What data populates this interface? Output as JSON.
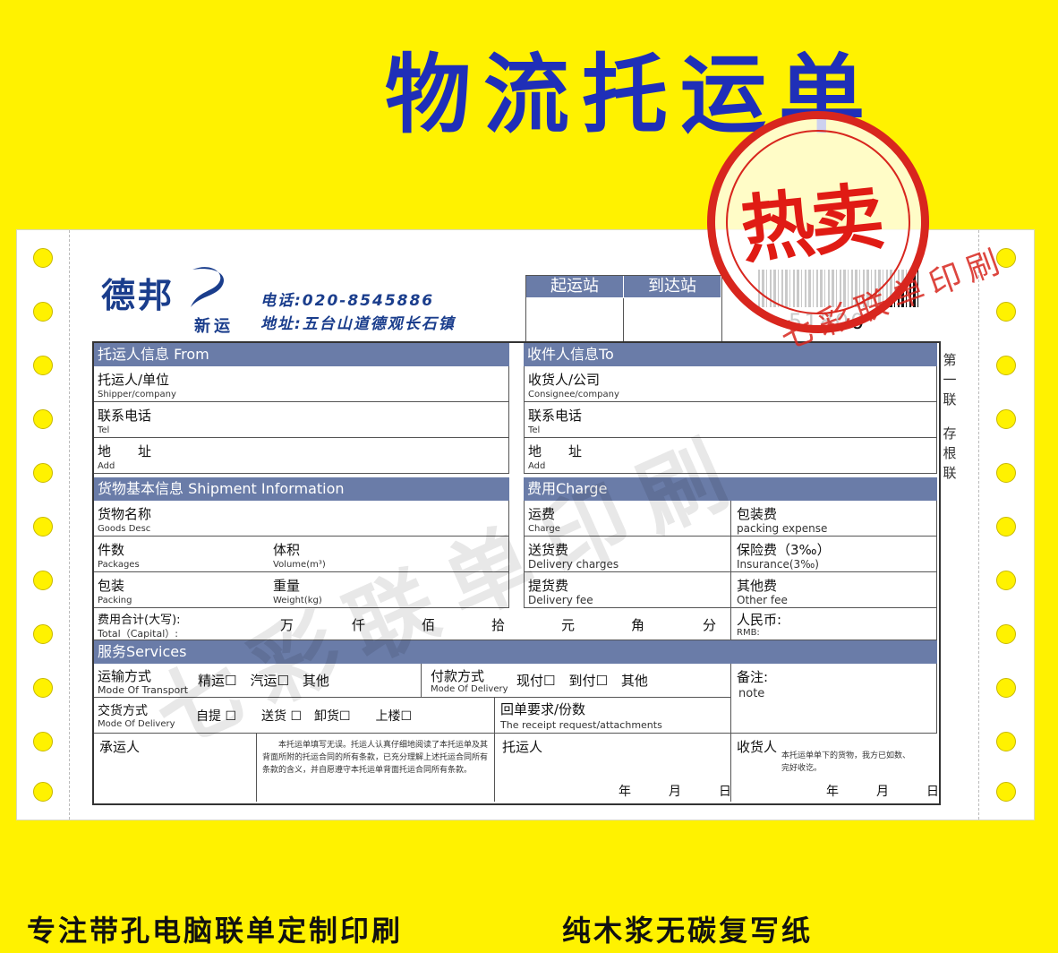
{
  "page_title": "物流托运单",
  "stamp": {
    "main": "热卖",
    "arc": "七彩联单印刷"
  },
  "watermark": "七彩联单印刷",
  "company": {
    "logo_text": "德邦",
    "logo_sub": "新运",
    "phone": "电话:020-8545886",
    "address": "地址:五台山道德观长石镇"
  },
  "stations": {
    "origin": "起运站",
    "destination": "到达站"
  },
  "barcode_number": "51800",
  "side_label": [
    "第一联",
    "存根联"
  ],
  "sections": {
    "shipper": "托运人信息 From",
    "consignee": "收件人信息To",
    "goods": "货物基本信息 Shipment Information",
    "charge": "费用Charge",
    "services": "服务Services"
  },
  "shipper": {
    "company": {
      "zh": "托运人/单位",
      "en": "Shipper/company"
    },
    "tel": {
      "zh": "联系电话",
      "en": "Tel"
    },
    "addr": {
      "zh": "地　　址",
      "en": "Add"
    }
  },
  "consignee": {
    "company": {
      "zh": "收货人/公司",
      "en": "Consignee/company"
    },
    "tel": {
      "zh": "联系电话",
      "en": "Tel"
    },
    "addr": {
      "zh": "地　　址",
      "en": "Add"
    }
  },
  "goods": {
    "name": {
      "zh": "货物名称",
      "en": "Goods Desc"
    },
    "packages": {
      "zh": "件数",
      "en": "Packages"
    },
    "volume": {
      "zh": "体积",
      "en": "Volume(m³)"
    },
    "packing": {
      "zh": "包装",
      "en": "Packing"
    },
    "weight": {
      "zh": "重量",
      "en": "Weight(kg)"
    }
  },
  "charge": {
    "freight": {
      "zh": "运费",
      "en": "Charge"
    },
    "packing_fee": {
      "zh": "包装费",
      "en": "packing expense"
    },
    "delivery": {
      "zh": "送货费",
      "en": "Delivery charges"
    },
    "insurance": {
      "zh": "保险费（3‰）",
      "en": "Insurance(3‰)"
    },
    "pickup": {
      "zh": "提货费",
      "en": "Delivery fee"
    },
    "other": {
      "zh": "其他费",
      "en": "Other fee"
    }
  },
  "total": {
    "zh": "费用合计(大写):",
    "en": "Total（Capital）:",
    "units": [
      "万",
      "仟",
      "佰",
      "拾",
      "元",
      "角",
      "分"
    ],
    "rmb_zh": "人民币:",
    "rmb_en": "RMB:"
  },
  "services": {
    "transport": {
      "zh": "运输方式",
      "en": "Mode Of Transport",
      "options": "精运☐　汽运☐　其他"
    },
    "payment": {
      "zh": "付款方式",
      "en": "Mode Of Delivery",
      "options": "现付☐　到付☐　其他"
    },
    "note": {
      "zh": "备注:",
      "en": "note"
    },
    "delivery_mode": {
      "zh": "交货方式",
      "en": "Mode Of Delivery",
      "options": "自提 ☐　　送货 ☐　卸货☐　　上楼☐"
    },
    "receipt": {
      "zh": "回单要求/份数",
      "en": "The receipt request/attachments"
    }
  },
  "signature": {
    "carrier": "承运人",
    "terms": "本托运单填写无误。托运人认真仔细地阅读了本托运单及其背面所附的托运合同的所有条款，已充分理解上述托运合同所有条款的含义，并自愿遵守本托运单背面托运合同所有条款。",
    "shipper": "托运人",
    "consignee": "收货人",
    "consignee_note": "本托运单单下的货物，我方已如数、完好收讫。",
    "date_shipper": "年　　　月　　　日",
    "date_consignee": "年　　　月　　　日"
  },
  "bottom": {
    "left": "专注带孔电脑联单定制印刷",
    "right": "纯木浆无碳复写纸"
  }
}
